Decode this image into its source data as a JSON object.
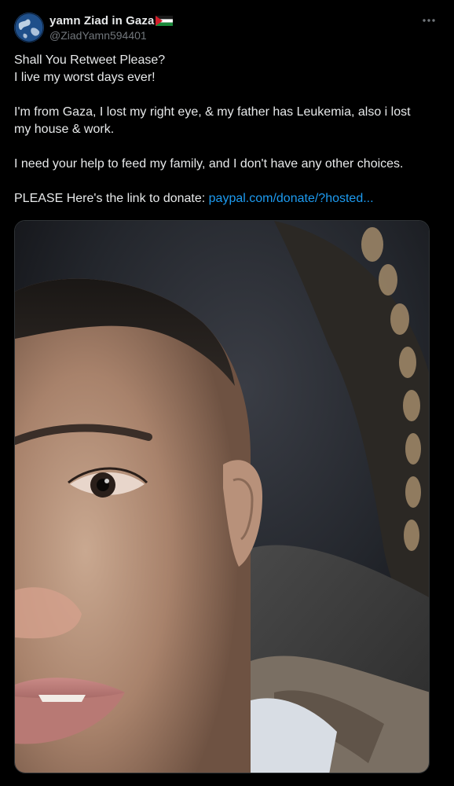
{
  "author": {
    "display_name": "yamn Ziad in Gaza",
    "handle": "@ZiadYamn594401",
    "avatar_icon": "globe-avatar",
    "flag_icon": "palestine-flag"
  },
  "more_icon": "more-horizontal-icon",
  "post": {
    "line1": "Shall You Retweet Please?",
    "line2": "I live my worst days ever!",
    "line3": "I'm from Gaza, I lost my right eye, & my father has Leukemia, also i lost my house & work.",
    "line4": "I need your help to feed my family, and I don't have any other choices.",
    "line5_prefix": "PLEASE Here's the link to donate: ",
    "link_text": "paypal.com/donate/?hosted..."
  },
  "media": {
    "kind": "photo",
    "description_icon": "selfie-photo"
  },
  "colors": {
    "background": "#000000",
    "text": "#e7e9ea",
    "secondary": "#71767b",
    "link": "#1d9bf0"
  }
}
